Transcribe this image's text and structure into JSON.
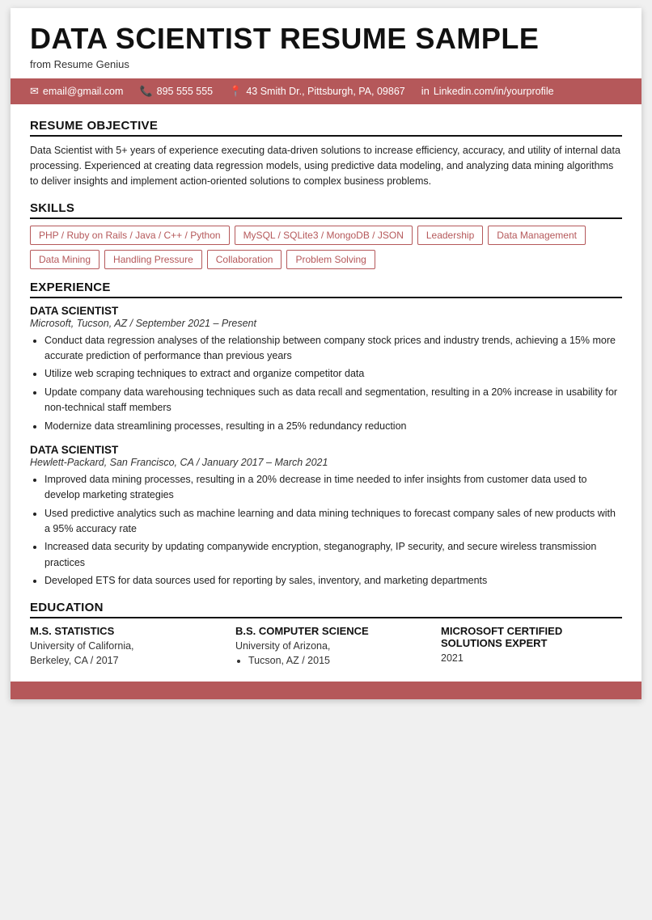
{
  "header": {
    "title": "DATA SCIENTIST RESUME SAMPLE",
    "subtitle": "from Resume Genius"
  },
  "contact": {
    "email": "email@gmail.com",
    "phone": "895 555 555",
    "address": "43 Smith Dr., Pittsburgh, PA, 09867",
    "linkedin": "Linkedin.com/in/yourprofile"
  },
  "objective": {
    "title": "RESUME OBJECTIVE",
    "text": "Data Scientist with 5+ years of experience executing data-driven solutions to increase efficiency, accuracy, and utility of internal data processing. Experienced at creating data regression models, using predictive data modeling, and analyzing data mining algorithms to deliver insights and implement action-oriented solutions to complex business problems."
  },
  "skills": {
    "title": "SKILLS",
    "tags": [
      "PHP / Ruby on Rails / Java / C++ / Python",
      "MySQL / SQLite3 / MongoDB / JSON",
      "Leadership",
      "Data Management",
      "Data Mining",
      "Handling Pressure",
      "Collaboration",
      "Problem Solving"
    ]
  },
  "experience": {
    "title": "EXPERIENCE",
    "jobs": [
      {
        "title": "DATA SCIENTIST",
        "meta": "Microsoft, Tucson, AZ  /  September 2021 – Present",
        "bullets": [
          "Conduct data regression analyses of the relationship between company stock prices and industry trends, achieving a 15% more accurate prediction of performance than previous years",
          "Utilize web scraping techniques to extract and organize competitor data",
          "Update company data warehousing techniques such as data recall and segmentation, resulting in a 20% increase in usability for non-technical staff members",
          "Modernize data streamlining processes, resulting in a 25% redundancy reduction"
        ]
      },
      {
        "title": "DATA SCIENTIST",
        "meta": "Hewlett-Packard, San Francisco, CA  /  January 2017 – March 2021",
        "bullets": [
          "Improved data mining processes, resulting in a 20% decrease in time needed to infer insights from customer data used to develop marketing strategies",
          "Used predictive analytics such as machine learning and data mining techniques to forecast company sales of new products with a 95% accuracy rate",
          "Increased data security by updating companywide encryption, steganography, IP security, and secure wireless transmission practices",
          "Developed ETS for data sources used for reporting by sales, inventory, and marketing departments"
        ]
      }
    ]
  },
  "education": {
    "title": "EDUCATION",
    "items": [
      {
        "degree": "M.S. STATISTICS",
        "details": [
          "University of California,",
          "Berkeley, CA  /  2017"
        ],
        "list": []
      },
      {
        "degree": "B.S. COMPUTER SCIENCE",
        "details": [
          "University of Arizona,"
        ],
        "list": [
          "Tucson, AZ  /  2015"
        ]
      },
      {
        "degree": "MICROSOFT CERTIFIED SOLUTIONS EXPERT",
        "details": [
          "2021"
        ],
        "list": []
      }
    ]
  }
}
